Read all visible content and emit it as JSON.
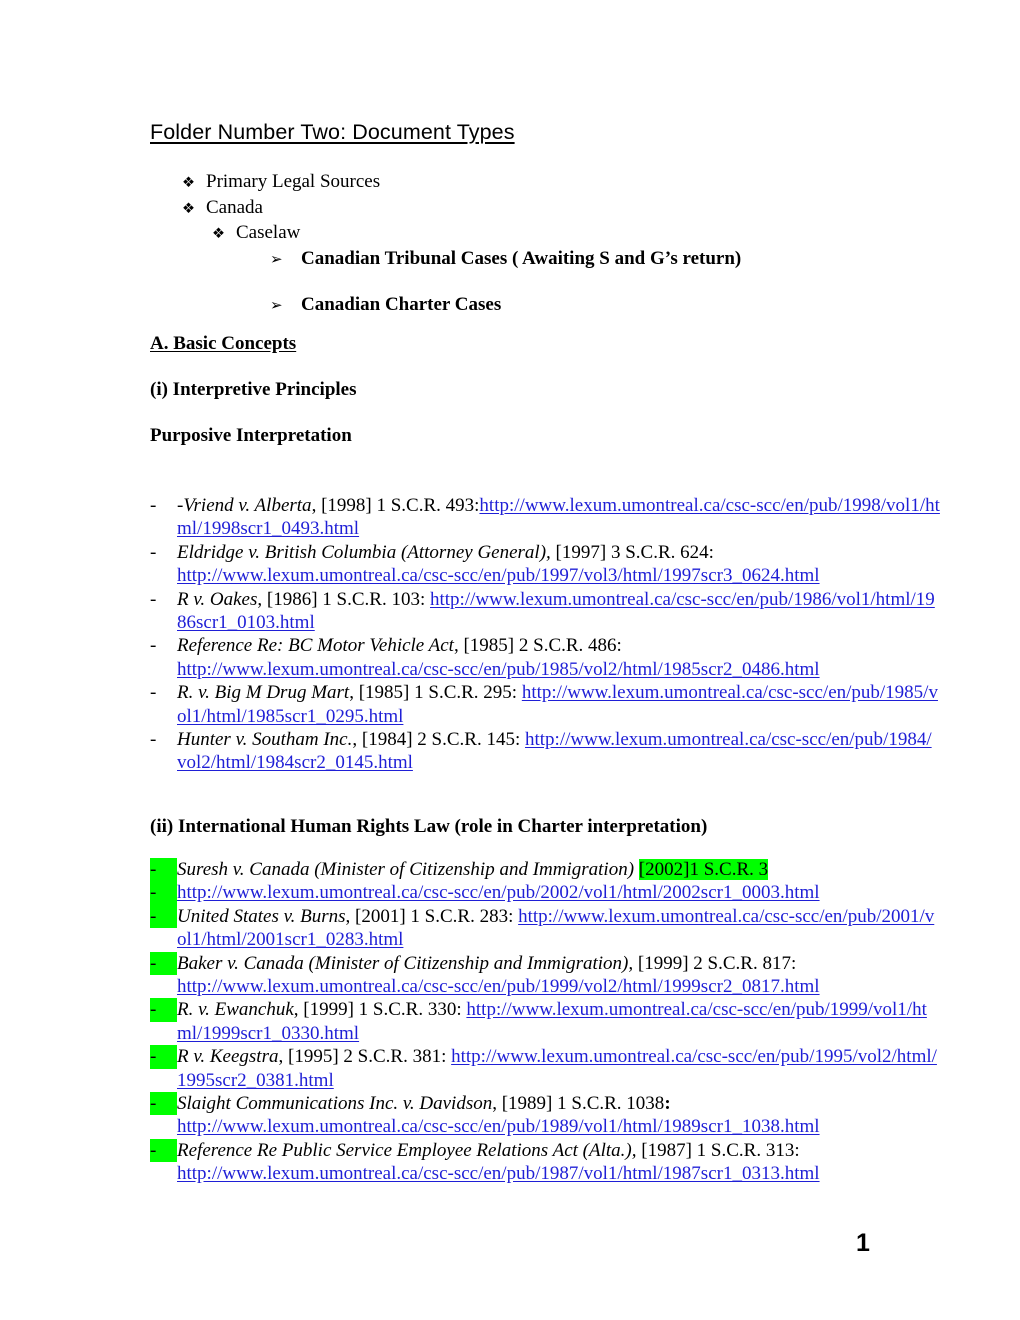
{
  "document": {
    "title": "Folder Number Two: Document Types",
    "page_number": "1"
  },
  "outline": {
    "diamond_bullet": "❖",
    "arrow_bullet": "➢",
    "items": [
      {
        "level": 1,
        "label": "Primary Legal Sources"
      },
      {
        "level": 1,
        "label": "Canada"
      },
      {
        "level": 2,
        "label": "Caselaw"
      },
      {
        "level": 3,
        "label": "Canadian Tribunal Cases ( Awaiting S and G’s return)"
      },
      {
        "level": 3,
        "label": "Canadian Charter Cases"
      }
    ]
  },
  "headings": {
    "basic_concepts": "A. Basic Concepts",
    "interpretive_principles": "(i) Interpretive Principles",
    "purposive_interpretation": "Purposive Interpretation",
    "international_human_rights": "(ii) International Human Rights Law  (role in Charter interpretation)"
  },
  "section_a": {
    "bullet": "-",
    "cases": [
      {
        "case": "-Vriend v. Alberta",
        "citation": ", [1998] 1 S.C.R. 493:",
        "url": "http://www.lexum.umontreal.ca/csc-scc/en/pub/1998/vol1/html/1998scr1_0493.html"
      },
      {
        "case": "Eldridge v. British Columbia (Attorney General),",
        "citation": " [1997] 3 S.C.R. 624:",
        "url": "http://www.lexum.umontreal.ca/csc-scc/en/pub/1997/vol3/html/1997scr3_0624.html"
      },
      {
        "case": "R v. Oakes",
        "citation": ", [1986] 1 S.C.R. 103: ",
        "url": "http://www.lexum.umontreal.ca/csc-scc/en/pub/1986/vol1/html/1986scr1_0103.html"
      },
      {
        "case": "Reference Re: BC Motor Vehicle Act",
        "citation": ", [1985] 2 S.C.R. 486:",
        "url": "http://www.lexum.umontreal.ca/csc-scc/en/pub/1985/vol2/html/1985scr2_0486.html"
      },
      {
        "case": "R. v. Big M Drug Mart",
        "citation": ", [1985] 1 S.C.R. 295: ",
        "url": "http://www.lexum.umontreal.ca/csc-scc/en/pub/1985/vol1/html/1985scr1_0295.html"
      },
      {
        "case": "Hunter v. Southam Inc.",
        "citation": ", [1984] 2 S.C.R. 145: ",
        "url": "http://www.lexum.umontreal.ca/csc-scc/en/pub/1984/vol2/html/1984scr2_0145.html"
      }
    ]
  },
  "section_b": {
    "bullet": "-",
    "highlight_color": "#00ff00",
    "cases": [
      {
        "case": "Suresh v. Canada (Minister of Citizenship and Immigration)",
        "citation_highlighted": "[2002]1 S.C.R. 3",
        "url": "",
        "highlighted": true
      },
      {
        "case": "",
        "citation": "",
        "url": "http://www.lexum.umontreal.ca/csc-scc/en/pub/2002/vol1/html/2002scr1_0003.html",
        "highlighted": true
      },
      {
        "case": "United States v. Burns",
        "citation": ", [2001] 1 S.C.R. 283: ",
        "url": "http://www.lexum.umontreal.ca/csc-scc/en/pub/2001/vol1/html/2001scr1_0283.html",
        "highlighted": true
      },
      {
        "case": "Baker v. Canada (Minister of Citizenship and Immigration),",
        "citation": " [1999] 2 S.C.R. 817:",
        "url": "http://www.lexum.umontreal.ca/csc-scc/en/pub/1999/vol2/html/1999scr2_0817.html",
        "highlighted": true
      },
      {
        "case": "R. v. Ewanchuk",
        "citation": ", [1999] 1 S.C.R. 330: ",
        "url": "http://www.lexum.umontreal.ca/csc-scc/en/pub/1999/vol1/html/1999scr1_0330.html",
        "highlighted": true
      },
      {
        "case": "R v. Keegstra",
        "citation": ", [1995] 2 S.C.R. 381: ",
        "url": "http://www.lexum.umontreal.ca/csc-scc/en/pub/1995/vol2/html/1995scr2_0381.html",
        "highlighted": true
      },
      {
        "case": "Slaight Communications Inc. v. Davidson",
        "citation": ", [1989] 1 S.C.R. 1038",
        "citation_bold_suffix": ":",
        "url": "http://www.lexum.umontreal.ca/csc-scc/en/pub/1989/vol1/html/1989scr1_1038.html",
        "highlighted": true
      },
      {
        "case": "Reference Re Public Service Employee Relations Act (Alta.),",
        "citation": " [1987] 1 S.C.R. 313:",
        "url": "http://www.lexum.umontreal.ca/csc-scc/en/pub/1987/vol1/html/1987scr1_0313.html",
        "highlighted": true
      }
    ]
  }
}
